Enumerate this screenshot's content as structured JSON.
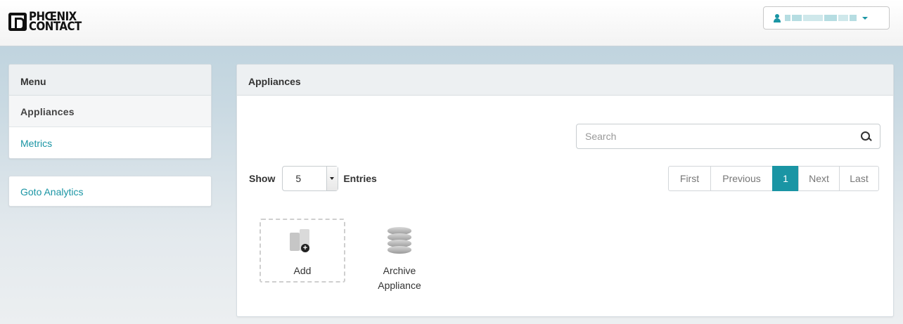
{
  "header": {
    "logo_line1": "PHŒNIX",
    "logo_line2": "CONTACT",
    "user_menu": {
      "caret": "chevron-down-icon"
    }
  },
  "sidebar": {
    "title": "Menu",
    "items": [
      {
        "label": "Appliances",
        "active": true
      },
      {
        "label": "Metrics",
        "active": false
      }
    ],
    "analytics_link": "Goto Analytics"
  },
  "main": {
    "title": "Appliances",
    "search": {
      "placeholder": "Search",
      "value": ""
    },
    "show_label": "Show",
    "entries_select": {
      "value": "5"
    },
    "entries_label": "Entries",
    "pagination": {
      "first": "First",
      "previous": "Previous",
      "current": "1",
      "next": "Next",
      "last": "Last"
    },
    "tiles": [
      {
        "label": "Add",
        "icon": "add-appliance-icon"
      },
      {
        "label_line1": "Archive",
        "label_line2": "Appliance",
        "icon": "database-icon"
      }
    ]
  },
  "colors": {
    "accent": "#1a95a4",
    "header_bg": "#f3f3f3",
    "panel_head_bg": "#edf0f2"
  }
}
